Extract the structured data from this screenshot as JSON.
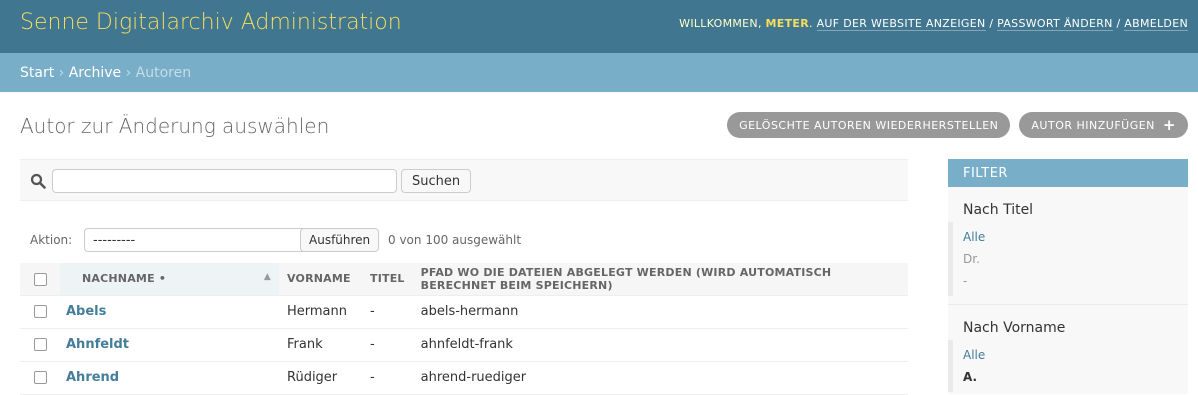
{
  "header": {
    "branding": "Senne Digitalarchiv Administration",
    "welcome": "Willkommen,",
    "username": "Meter",
    "view_site": "Auf der Website anzeigen",
    "change_password": "Passwort ändern",
    "logout": "Abmelden",
    "separator": "/"
  },
  "breadcrumbs": {
    "home": "Start",
    "app": "Archive",
    "current": "Autoren",
    "separator": "›"
  },
  "page": {
    "title": "Autor zur Änderung auswählen",
    "recover_button": "Gelöschte Autoren wiederherstellen",
    "add_button": "Autor hinzufügen",
    "add_icon": "+"
  },
  "search": {
    "value": "",
    "button": "Suchen",
    "icon": "search-icon"
  },
  "actions": {
    "label": "Aktion:",
    "selected_option": "---------",
    "go_button": "Ausführen",
    "counter": "0 von 100 ausgewählt"
  },
  "table": {
    "columns": {
      "nachname": "Nachname",
      "sort_marker": "•",
      "vorname": "Vorname",
      "titel": "Titel",
      "pfad": "Pfad wo die Dateien abgelegt werden (wird automatisch berechnet beim Speichern)"
    },
    "rows": [
      {
        "nachname": "Abels",
        "vorname": "Hermann",
        "titel": "-",
        "pfad": "abels-hermann"
      },
      {
        "nachname": "Ahnfeldt",
        "vorname": "Frank",
        "titel": "-",
        "pfad": "ahnfeldt-frank"
      },
      {
        "nachname": "Ahrend",
        "vorname": "Rüdiger",
        "titel": "-",
        "pfad": "ahrend-ruediger"
      }
    ]
  },
  "filter": {
    "heading": "Filter",
    "groups": [
      {
        "title": "Nach Titel",
        "items": [
          "Alle",
          "Dr.",
          "-"
        ]
      },
      {
        "title": "Nach Vorname",
        "items": [
          "Alle",
          "A."
        ]
      }
    ]
  },
  "colors": {
    "header_bg": "#417690",
    "branding": "#f5dd5d",
    "breadcrumb_bg": "#79aec8",
    "link": "#447e9b",
    "button_bg": "#999999"
  }
}
